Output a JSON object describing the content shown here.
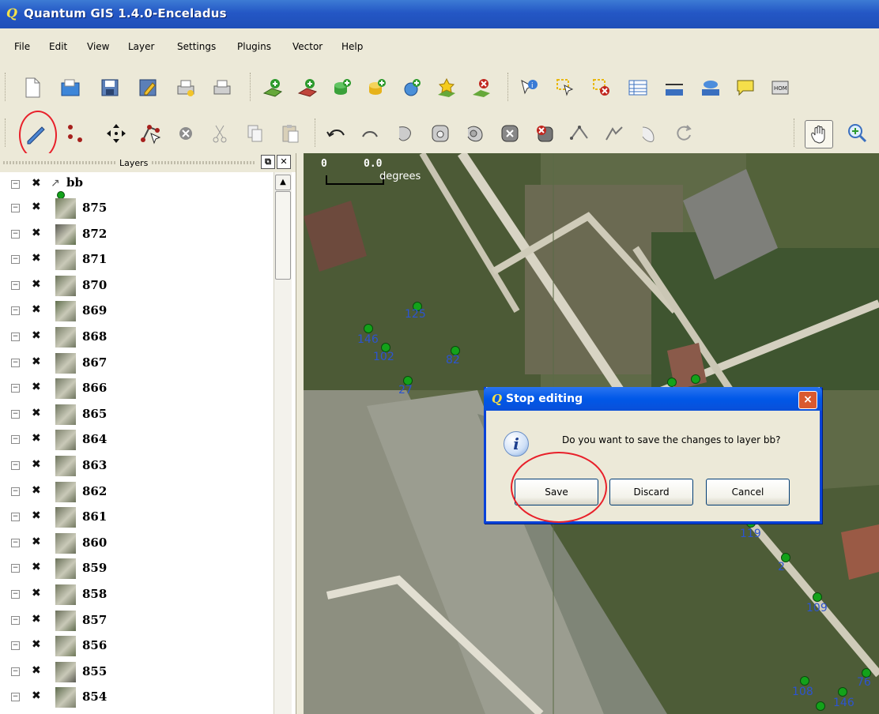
{
  "window": {
    "title": "Quantum GIS 1.4.0-Enceladus",
    "app_icon": "qgis-icon"
  },
  "menu": [
    "File",
    "Edit",
    "View",
    "Layer",
    "Settings",
    "Plugins",
    "Vector",
    "Help"
  ],
  "layers_panel": {
    "title": "Layers",
    "group": {
      "name": "bb",
      "icon": "line-edit-icon"
    },
    "items": [
      "875",
      "872",
      "871",
      "870",
      "869",
      "868",
      "867",
      "866",
      "865",
      "864",
      "863",
      "862",
      "861",
      "860",
      "859",
      "858",
      "857",
      "856",
      "855",
      "854"
    ]
  },
  "map": {
    "scalebar": {
      "zero": "0",
      "value": "0.0",
      "unit": "degrees"
    },
    "point_labels": [
      "125",
      "146",
      "102",
      "82",
      "27",
      "119",
      "2",
      "109",
      "108",
      "146",
      "76"
    ]
  },
  "dialog": {
    "title": "Stop editing",
    "message": "Do you want to save the changes to layer bb?",
    "buttons": {
      "save": "Save",
      "discard": "Discard",
      "cancel": "Cancel"
    },
    "close": "×"
  },
  "colors": {
    "titlebar": "#2457c5",
    "dialog_border": "#0842d9",
    "highlight": "#e8202a",
    "point": "#13a21a",
    "point_label": "#2c54d0"
  }
}
